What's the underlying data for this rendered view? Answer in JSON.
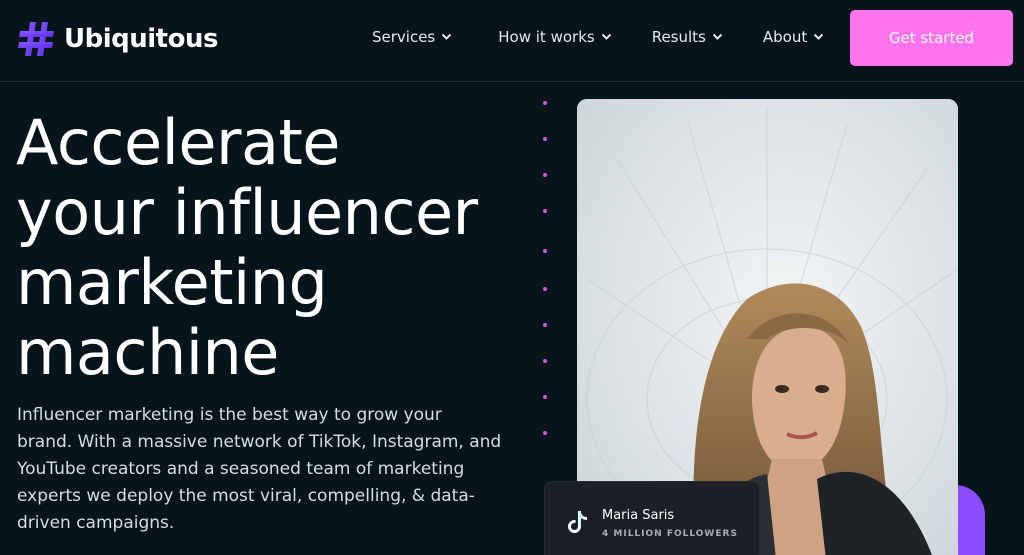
{
  "header": {
    "logo_text": "Ubiquitous",
    "nav": [
      {
        "label": "Services"
      },
      {
        "label": "How it works"
      },
      {
        "label": "Results"
      },
      {
        "label": "About"
      }
    ],
    "cta_label": "Get started"
  },
  "hero": {
    "title_lines": [
      "Accelerate",
      "your influencer",
      "marketing",
      "machine"
    ],
    "copy": "Influencer marketing is the best way to grow your brand. With a massive network of TikTok, Instagram, and YouTube creators and a seasoned team of marketing experts we deploy the most viral, compelling, & data-driven campaigns."
  },
  "profile": {
    "name": "Maria Saris",
    "followers": "4 MILLION FOLLOWERS"
  },
  "colors": {
    "background": "#06141b",
    "accent_pink": "#ff73ee",
    "accent_purple": "#8b4dff",
    "dot": "#d55bd6"
  },
  "icons": {
    "logo": "hashtag-icon",
    "chevron": "chevron-down-icon",
    "social": "tiktok-icon"
  }
}
